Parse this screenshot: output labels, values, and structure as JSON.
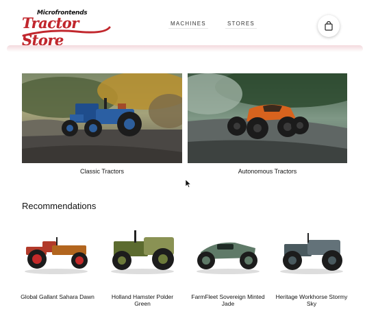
{
  "header": {
    "logo_small": "Microfrontends",
    "logo_big": "Tractor Store",
    "nav": [
      "MACHINES",
      "STORES"
    ],
    "cart_icon": "shopping-bag-icon"
  },
  "categories": [
    {
      "label": "Classic Tractors"
    },
    {
      "label": "Autonomous Tractors"
    }
  ],
  "recommendations": {
    "title": "Recommendations",
    "items": [
      {
        "name": "Global Gallant Sahara Dawn"
      },
      {
        "name": "Holland Hamster Polder Green"
      },
      {
        "name": "FarmFleet Sovereign Minted Jade"
      },
      {
        "name": "Heritage Workhorse Stormy Sky"
      }
    ]
  },
  "colors": {
    "brand": "#c1272d",
    "header_shadow": "#f3d9dd"
  }
}
